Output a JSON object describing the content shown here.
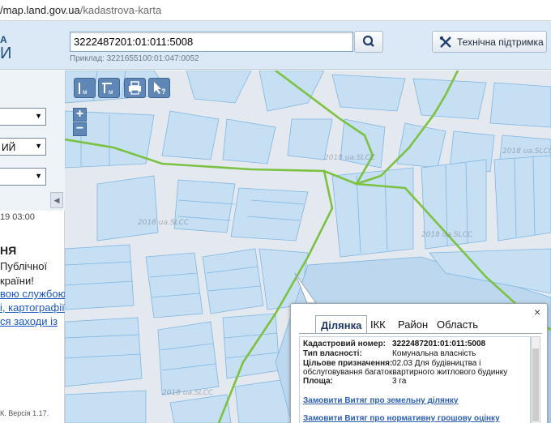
{
  "browser": {
    "url_host": "/map.land.gov.ua",
    "url_path": "/kadastrova-karta"
  },
  "header": {
    "logo_line1": "А",
    "logo_line2": "И",
    "search_value": "3222487201:01:011:5008",
    "example": "Приклад: 3221655100:01:047:0052",
    "support_label": "Технічна підтримка"
  },
  "sidebar": {
    "dropdowns": [
      "",
      "ИЙ",
      ""
    ],
    "news_date": "19 03:00",
    "news_title": "НЯ",
    "news_lines": [
      "Публічної",
      "країни!"
    ],
    "news_links": [
      "вою  службою",
      "і,  картографії",
      "ся  заходи  із"
    ],
    "footer": "К. Версія 1.17."
  },
  "map": {
    "toolbar": [
      "ruler-distance",
      "ruler-area",
      "print",
      "identify"
    ],
    "zoom_in": "+",
    "zoom_out": "−",
    "watermark": "2018 ua.SLCC",
    "popup": {
      "tabs": [
        "Ділянка",
        "ІКК",
        "Район",
        "Область"
      ],
      "active_tab": "Ділянка",
      "close": "×",
      "rows": [
        {
          "label": "Кадастровий номер:",
          "value": "3222487201:01:011:5008"
        },
        {
          "label": "Тип власності:",
          "value": "Комунальна власність"
        },
        {
          "label": "Цільове призначення:",
          "value": "02.03 Для будівництва і"
        },
        {
          "label": "",
          "value": "обслуговування багатоквартирного житлового будинку"
        },
        {
          "label": "Площа:",
          "value": "3 га"
        }
      ],
      "links": [
        "Замовити Витяг про земельну ділянку",
        "Замовити Витяг про нормативну грошову оцінку"
      ]
    }
  },
  "colors": {
    "parcel_fill": "#c7dff2",
    "parcel_stroke": "#7eb6e3",
    "road": "#7cc242",
    "map_bg": "#e4e9ef",
    "header_bg": "#dbe8f5"
  }
}
